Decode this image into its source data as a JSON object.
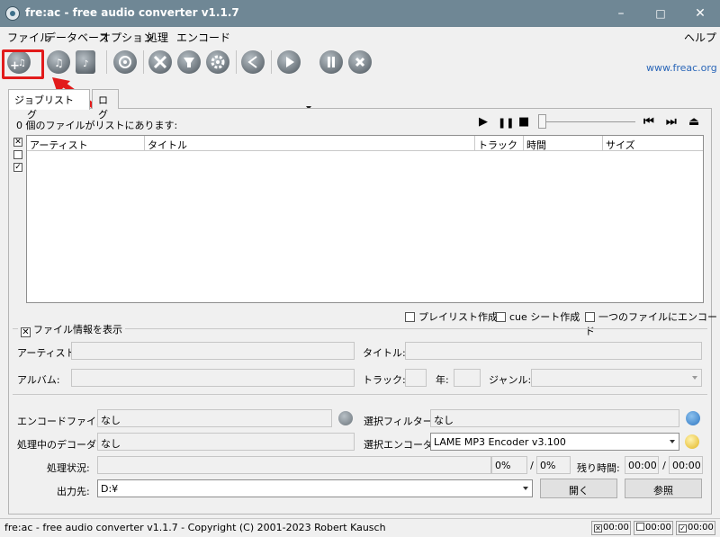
{
  "window": {
    "title": "fre:ac - free audio converter v1.1.7",
    "minimize": "–",
    "maximize": "□",
    "close": "✕"
  },
  "menu": {
    "items": [
      "ファイル",
      "データベース",
      "オプション",
      "処理",
      "エンコード"
    ],
    "help": "ヘルプ"
  },
  "toolbar": {
    "website": "www.freac.org",
    "icons": [
      "add-files-icon",
      "add-cd-tracks-icon",
      "add-file-icon",
      "cddb-query-icon",
      "configure-icon",
      "filter-icon",
      "settings-icon",
      "share-icon",
      "start-encoding-icon",
      "pause-icon",
      "stop-icon"
    ],
    "highlight_color": "#e21b1b"
  },
  "tabs": {
    "joblist_part1": "ジョブリスト",
    "joblist_part2": "グ",
    "log": "ログ"
  },
  "joblist": {
    "file_count_text": "0 個のファイルがリストにあります:",
    "columns": [
      "アーティスト",
      "タイトル",
      "トラック",
      "時間",
      "サイズ"
    ],
    "rows": []
  },
  "player": {
    "play": "▶",
    "pause": "❚❚",
    "stop": "■",
    "prev": "⏮",
    "next": "⏭",
    "eject": "⏏"
  },
  "options": {
    "playlist": "プレイリスト作成",
    "cue_sheet": "cue シート作成",
    "single_file": "一つのファイルにエンコード"
  },
  "file_info": {
    "show_label": "ファイル情報を表示",
    "artist_label": "アーティスト:",
    "title_label": "タイトル:",
    "album_label": "アルバム:",
    "track_label": "トラック:",
    "year_label": "年:",
    "genre_label": "ジャンル:"
  },
  "encode": {
    "encode_file_label": "エンコードファイル:",
    "encode_file_value": "なし",
    "selection_filter_label": "選択フィルター:",
    "selection_filter_value": "なし",
    "decoder_label": "処理中のデコーダ:",
    "decoder_value": "なし",
    "encoder_label": "選択エンコーダ:",
    "encoder_value": "LAME MP3 Encoder v3.100",
    "progress_label": "処理状況:",
    "progress_percent_1": "0%",
    "progress_slash": "/",
    "progress_percent_2": "0%",
    "remaining_label": "残り時間:",
    "remaining_1": "00:00",
    "remaining_slash": "/",
    "remaining_2": "00:00",
    "output_label": "出力先:",
    "output_value": "D:¥",
    "open_button": "開く",
    "browse_button": "参照"
  },
  "status": {
    "text": "fre:ac - free audio converter v1.1.7 - Copyright (C) 2001-2023 Robert Kausch",
    "time_1": "00:00",
    "time_2": "00:00",
    "time_3": "00:00"
  }
}
